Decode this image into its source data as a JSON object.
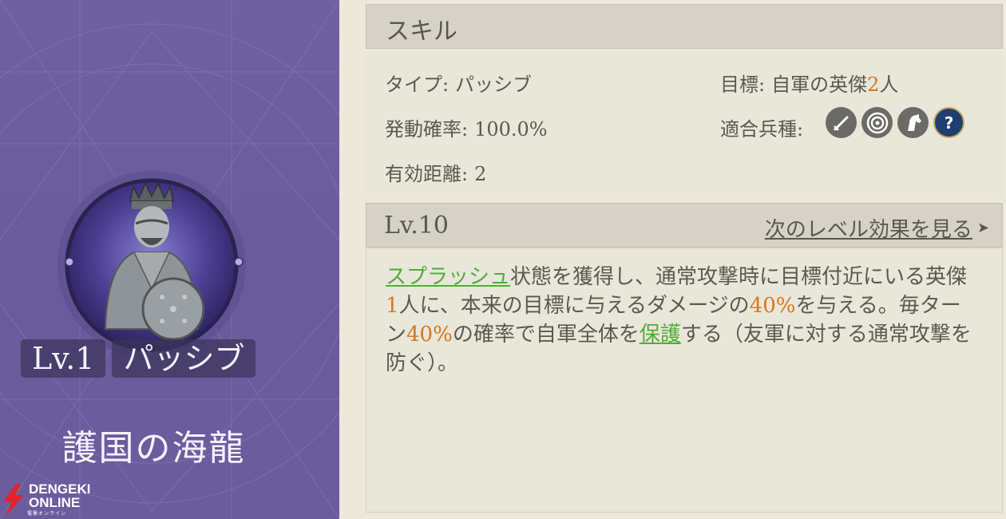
{
  "left": {
    "level_tag": "Lv.1",
    "type_tag": "パッシブ",
    "skill_name": "護国の海龍",
    "logo_line1": "DENGEKI",
    "logo_line2": "ONLINE",
    "logo_small": "電撃オンライン"
  },
  "skill_section": {
    "title": "スキル",
    "type_label": "タイプ:",
    "type_value": "パッシブ",
    "rate_label": "発動確率:",
    "rate_value": "100.0%",
    "range_label": "有効距離:",
    "range_value": "2",
    "target_label": "目標:",
    "target_value_prefix": "自軍の英傑",
    "target_value_count": "2",
    "target_value_suffix": "人",
    "unit_label": "適合兵種:",
    "unit_icons": [
      "sword-icon",
      "target-icon",
      "horse-icon",
      "question-icon"
    ]
  },
  "level_section": {
    "level": "Lv.10",
    "next_link": "次のレベル効果を見る",
    "next_arrow": "➤"
  },
  "description": {
    "s1": "スプラッシュ",
    "s2": "状態を獲得し、通常攻撃時に目標付近にいる英傑",
    "s3": "1",
    "s4": "人に、本来の目標に与えるダメージの",
    "s5": "40%",
    "s6": "を与える。毎ターン",
    "s7": "40%",
    "s8": "の確率で自軍全体を",
    "s9": "保護",
    "s10": "する（友軍に対する通常攻撃を防ぐ）。"
  },
  "colors": {
    "panel_purple": "#6c5d9f",
    "highlight_orange": "#d7771d",
    "keyword_green": "#4fae37"
  }
}
